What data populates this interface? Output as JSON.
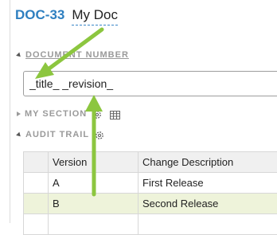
{
  "header": {
    "doc_id": "DOC-33",
    "doc_title": "My Doc"
  },
  "document_number": {
    "label": "DOCUMENT NUMBER",
    "value": "_title_ _revision_"
  },
  "my_section": {
    "label": "MY SECTION",
    "icons": [
      "gear-icon",
      "table-icon"
    ]
  },
  "audit_trail": {
    "label": "AUDIT TRAIL",
    "icons": [
      "gear-icon"
    ],
    "columns": [
      "",
      "Version",
      "Change Description"
    ],
    "rows": [
      {
        "version": "A",
        "description": "First Release"
      },
      {
        "version": "B",
        "description": "Second Release"
      }
    ],
    "highlight_color": "#eef3da"
  },
  "colors": {
    "doc_id": "#2e7fc0",
    "arrow": "#8cc63f"
  }
}
